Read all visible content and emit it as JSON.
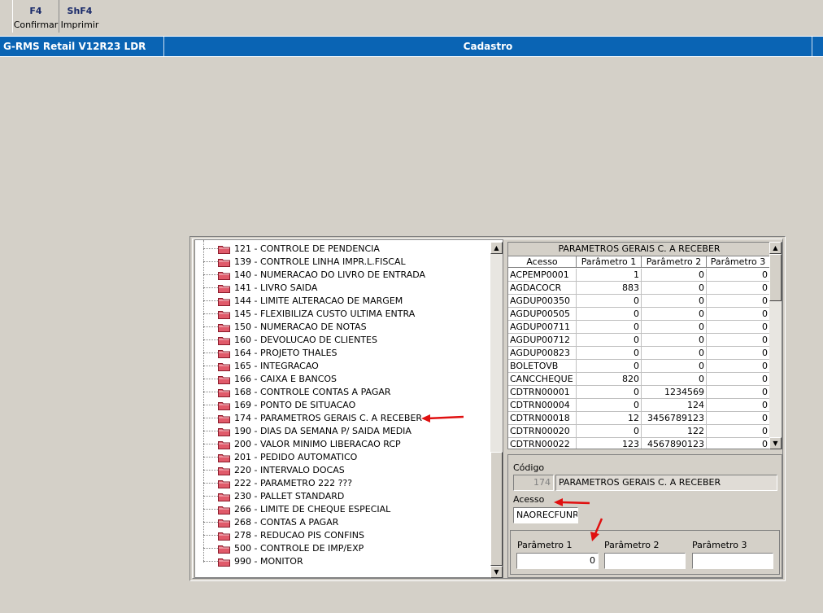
{
  "toolbar": {
    "f4": {
      "key": "F4",
      "label": "Confirmar"
    },
    "shf4": {
      "key": "ShF4",
      "label": "Imprimir"
    }
  },
  "titlebar": {
    "app": "G-RMS Retail V12R23 LDR",
    "center": "Cadastro"
  },
  "tree": {
    "items": [
      "121 - CONTROLE DE PENDENCIA",
      "139 - CONTROLE LINHA IMPR.L.FISCAL",
      "140 - NUMERACAO DO LIVRO DE ENTRADA",
      "141 - LIVRO SAIDA",
      "144 - LIMITE ALTERACAO DE MARGEM",
      "145 - FLEXIBILIZA CUSTO ULTIMA ENTRA",
      "150 - NUMERACAO DE NOTAS",
      "160 - DEVOLUCAO DE CLIENTES",
      "164 - PROJETO THALES",
      "165 - INTEGRACAO",
      "166 - CAIXA E BANCOS",
      "168 - CONTROLE CONTAS A PAGAR",
      "169 - PONTO DE SITUACAO",
      "174 - PARAMETROS GERAIS C. A RECEBER",
      "190 - DIAS DA SEMANA P/ SAIDA MEDIA",
      "200 - VALOR MINIMO LIBERACAO RCP",
      "201 - PEDIDO AUTOMATICO",
      "220 - INTERVALO DOCAS",
      "222 - PARAMETRO 222 ???",
      "230 - PALLET STANDARD",
      "266 - LIMITE DE CHEQUE ESPECIAL",
      "268 - CONTAS A PAGAR",
      "278 - REDUCAO PIS CONFINS",
      "500 - CONTROLE DE IMP/EXP",
      "990 - MONITOR"
    ]
  },
  "grid": {
    "title": "PARAMETROS GERAIS C. A RECEBER",
    "headers": [
      "Acesso",
      "Parâmetro 1",
      "Parâmetro 2",
      "Parâmetro 3"
    ],
    "rows": [
      [
        "ACPEMP0001",
        "1",
        "0",
        "0"
      ],
      [
        "AGDACOCR",
        "883",
        "0",
        "0"
      ],
      [
        "AGDUP00350",
        "0",
        "0",
        "0"
      ],
      [
        "AGDUP00505",
        "0",
        "0",
        "0"
      ],
      [
        "AGDUP00711",
        "0",
        "0",
        "0"
      ],
      [
        "AGDUP00712",
        "0",
        "0",
        "0"
      ],
      [
        "AGDUP00823",
        "0",
        "0",
        "0"
      ],
      [
        "BOLETOVB",
        "0",
        "0",
        "0"
      ],
      [
        "CANCCHEQUE",
        "820",
        "0",
        "0"
      ],
      [
        "CDTRN00001",
        "0",
        "1234569",
        "0"
      ],
      [
        "CDTRN00004",
        "0",
        "124",
        "0"
      ],
      [
        "CDTRN00018",
        "12",
        "3456789123",
        "0"
      ],
      [
        "CDTRN00020",
        "0",
        "122",
        "0"
      ],
      [
        "CDTRN00022",
        "123",
        "4567890123",
        "0"
      ]
    ]
  },
  "form": {
    "codigo_label": "Código",
    "codigo_value": "174",
    "descricao_value": "PARAMETROS GERAIS C. A RECEBER",
    "acesso_label": "Acesso",
    "acesso_value": "NAORECFUNR",
    "p1_label": "Parâmetro 1",
    "p1_value": "0",
    "p2_label": "Parâmetro 2",
    "p2_value": "",
    "p3_label": "Parâmetro 3",
    "p3_value": ""
  },
  "colors": {
    "titlebar": "#0a64b4",
    "folder": "#e05a6a",
    "annotation_arrow": "#e01010"
  }
}
